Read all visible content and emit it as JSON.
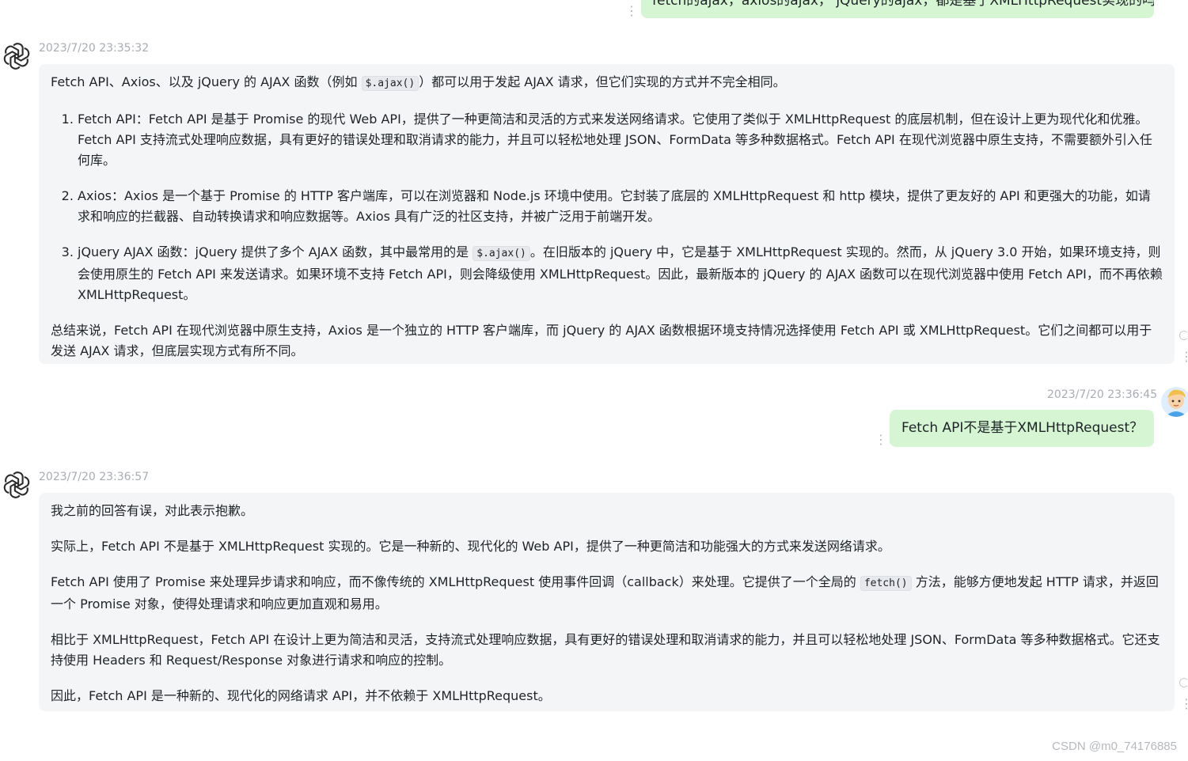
{
  "top_message": {
    "text": "fetch的ajax，axios的ajax，  jQuery的ajax，都是基于XMLHttpRequest实现的吗"
  },
  "bot_message_1": {
    "timestamp": "2023/7/20 23:35:32",
    "intro_a": "Fetch API、Axios、以及 jQuery 的 AJAX 函数（例如 ",
    "intro_code": "$.ajax()",
    "intro_b": "）都可以用于发起 AJAX 请求，但它们实现的方式并不完全相同。",
    "item1": "Fetch API：Fetch API 是基于 Promise 的现代 Web API，提供了一种更简洁和灵活的方式来发送网络请求。它使用了类似于 XMLHttpRequest 的底层机制，但在设计上更为现代化和优雅。Fetch API 支持流式处理响应数据，具有更好的错误处理和取消请求的能力，并且可以轻松地处理 JSON、FormData 等多种数据格式。Fetch API 在现代浏览器中原生支持，不需要额外引入任何库。",
    "item2": "Axios：Axios 是一个基于 Promise 的 HTTP 客户端库，可以在浏览器和 Node.js 环境中使用。它封装了底层的 XMLHttpRequest 和 http 模块，提供了更友好的 API 和更强大的功能，如请求和响应的拦截器、自动转换请求和响应数据等。Axios 具有广泛的社区支持，并被广泛用于前端开发。",
    "item3_a": "jQuery AJAX 函数：jQuery 提供了多个 AJAX 函数，其中最常用的是 ",
    "item3_code": "$.ajax()",
    "item3_b": "。在旧版本的 jQuery 中，它是基于 XMLHttpRequest 实现的。然而，从 jQuery 3.0 开始，如果环境支持，则会使用原生的 Fetch API 来发送请求。如果环境不支持 Fetch API，则会降级使用 XMLHttpRequest。因此，最新版本的 jQuery 的 AJAX 函数可以在现代浏览器中使用 Fetch API，而不再依赖 XMLHttpRequest。",
    "summary": "总结来说，Fetch API 在现代浏览器中原生支持，Axios 是一个独立的 HTTP 客户端库，而 jQuery 的 AJAX 函数根据环境支持情况选择使用 Fetch API 或 XMLHttpRequest。它们之间都可以用于发送 AJAX 请求，但底层实现方式有所不同。"
  },
  "user_message_2": {
    "timestamp": "2023/7/20 23:36:45",
    "text": "Fetch API不是基于XMLHttpRequest？"
  },
  "bot_message_2": {
    "timestamp": "2023/7/20 23:36:57",
    "p1": "我之前的回答有误，对此表示抱歉。",
    "p2": "实际上，Fetch API 不是基于 XMLHttpRequest 实现的。它是一种新的、现代化的 Web API，提供了一种更简洁和功能强大的方式来发送网络请求。",
    "p3_a": "Fetch API 使用了 Promise 来处理异步请求和响应，而不像传统的 XMLHttpRequest 使用事件回调（callback）来处理。它提供了一个全局的 ",
    "p3_code": "fetch()",
    "p3_b": " 方法，能够方便地发起 HTTP 请求，并返回一个 Promise 对象，使得处理请求和响应更加直观和易用。",
    "p4": "相比于 XMLHttpRequest，Fetch API 在设计上更为简洁和灵活，支持流式处理响应数据，具有更好的错误处理和取消请求的能力，并且可以轻松地处理 JSON、FormData 等多种数据格式。它还支持使用 Headers 和 Request/Response 对象进行请求和响应的控制。",
    "p5": "因此，Fetch API 是一种新的、现代化的网络请求 API，并不依赖于 XMLHttpRequest。"
  },
  "watermark": "CSDN @m0_74176885",
  "icons": {
    "bot_avatar": "openai-logo-icon",
    "user_avatar": "cartoon-avatar-icon",
    "more": "vertical-dots-icon"
  },
  "colors": {
    "user_bubble": "#d5f5d3",
    "bot_card": "#f4f5f7",
    "timestamp": "#a8acb3"
  }
}
